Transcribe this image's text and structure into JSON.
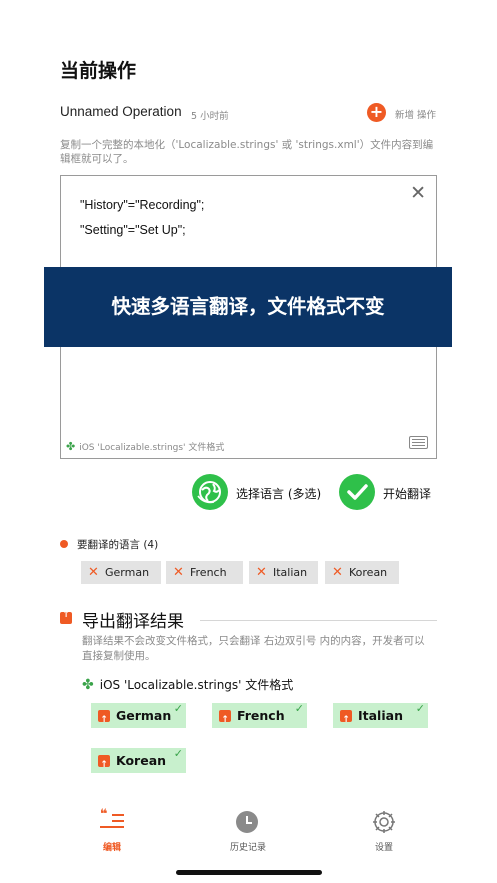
{
  "page_title": "当前操作",
  "operation": {
    "name": "Unnamed Operation",
    "time": "5 小时前",
    "add_label": "新增 操作"
  },
  "hint": "复制一个完整的本地化（'Localizable.strings' 或 'strings.xml'）文件内容到编辑框就可以了。",
  "editor": {
    "lines": [
      "\"History\"=\"Recording\";",
      "\"Setting\"=\"Set Up\";"
    ],
    "format": "iOS 'Localizable.strings' 文件格式"
  },
  "banner": "快速多语言翻译，文件格式不变",
  "actions": {
    "select_languages": "选择语言 (多选)",
    "start_translation": "开始翻译"
  },
  "languages": {
    "header": "要翻译的语言 (4)",
    "items": [
      "German",
      "French",
      "Italian",
      "Korean"
    ]
  },
  "export": {
    "title": "导出翻译结果",
    "description": "翻译结果不会改变文件格式，只会翻译 右边双引号 内的内容，开发者可以直接复制使用。",
    "format": "iOS 'Localizable.strings' 文件格式",
    "results": [
      "German",
      "French",
      "Italian",
      "Korean"
    ]
  },
  "tabs": {
    "edit": "编辑",
    "history": "历史记录",
    "settings": "设置"
  },
  "colors": {
    "accent": "#ef5a24",
    "green": "#2fc04a",
    "banner": "#0b3466",
    "result_chip": "#c8f0cd"
  }
}
